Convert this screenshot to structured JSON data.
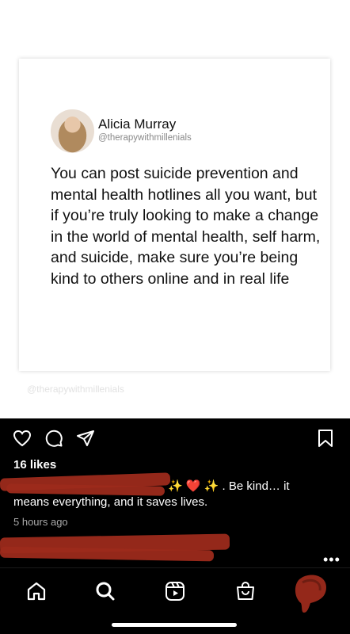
{
  "post_image": {
    "author": {
      "name": "Alicia Murray",
      "handle": "@therapywithmillenials"
    },
    "quote": "You can post suicide prevention and mental health hotlines all you want, but if you’re truly looking to make a change in the world of mental health, self harm, and suicide, make sure you’re being kind to others online and in real life",
    "watermark": "@therapywithmillenials"
  },
  "actions": {
    "like_icon": "heart-outline",
    "comment_icon": "speech-bubble",
    "share_icon": "paper-plane",
    "save_icon": "bookmark"
  },
  "likes": "16 likes",
  "caption": {
    "emoji": "✨ ❤️ ✨",
    "line1_end": ". Be kind… it",
    "line2": "means everything, and it saves lives."
  },
  "timestamp": "5 hours ago",
  "more": "•••",
  "nav": {
    "items": [
      "home-icon",
      "search-icon",
      "reels-icon",
      "shop-icon",
      "profile-avatar"
    ]
  },
  "colors": {
    "redaction": "#9c2a1b",
    "background": "#000000"
  }
}
